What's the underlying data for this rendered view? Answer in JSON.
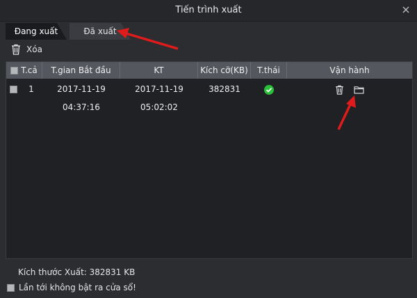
{
  "window": {
    "title": "Tiến trình xuất"
  },
  "tabs": [
    {
      "label": "Đang xuất",
      "active": true
    },
    {
      "label": "Đã xuất",
      "active": false
    }
  ],
  "toolbar": {
    "delete_label": "Xóa"
  },
  "table": {
    "headers": [
      "T.cả",
      "T.gian Bắt đầu",
      "KT",
      "Kích cỡ(KB)",
      "T.thái",
      "Vận hành"
    ],
    "rows": [
      {
        "index": "1",
        "start": "2017-11-19 04:37:16",
        "end": "2017-11-19 05:02:02",
        "size": "382831",
        "status": "success-check-icon"
      }
    ]
  },
  "footer": {
    "export_size": "Kích thước Xuất: 382831 KB",
    "no_popup_label": "Lần tới không bật ra cửa sổ!"
  },
  "colors": {
    "annotation_red": "#e01b1b",
    "status_green": "#2bbf3a"
  }
}
